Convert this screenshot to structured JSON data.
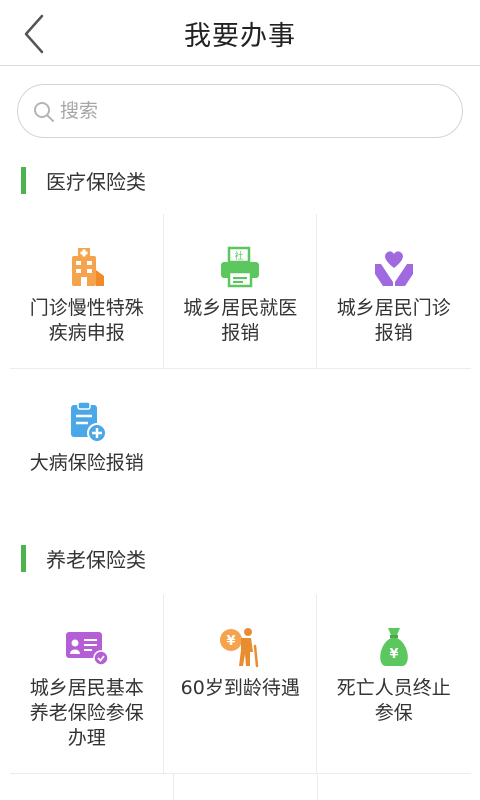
{
  "header": {
    "title": "我要办事"
  },
  "search": {
    "placeholder": "搜索"
  },
  "sections": [
    {
      "title": "医疗保险类",
      "items": [
        {
          "label": "门诊慢性特殊疾病申报",
          "icon": "hospital-icon",
          "color": "#f5a34d"
        },
        {
          "label": "城乡居民就医报销",
          "icon": "printer-icon",
          "color": "#5cc65f"
        },
        {
          "label": "城乡居民门诊报销",
          "icon": "hands-heart-icon",
          "color": "#a069e0"
        },
        {
          "label": "大病保险报销",
          "icon": "clipboard-plus-icon",
          "color": "#4aa7e8"
        }
      ]
    },
    {
      "title": "养老保险类",
      "items": [
        {
          "label": "城乡居民基本养老保险参保办理",
          "icon": "card-icon",
          "color": "#b55fd6"
        },
        {
          "label": "60岁到龄待遇",
          "icon": "elder-coin-icon",
          "color": "#f5a34d"
        },
        {
          "label": "死亡人员终止参保",
          "icon": "money-bag-icon",
          "color": "#5cc65f"
        }
      ]
    }
  ]
}
